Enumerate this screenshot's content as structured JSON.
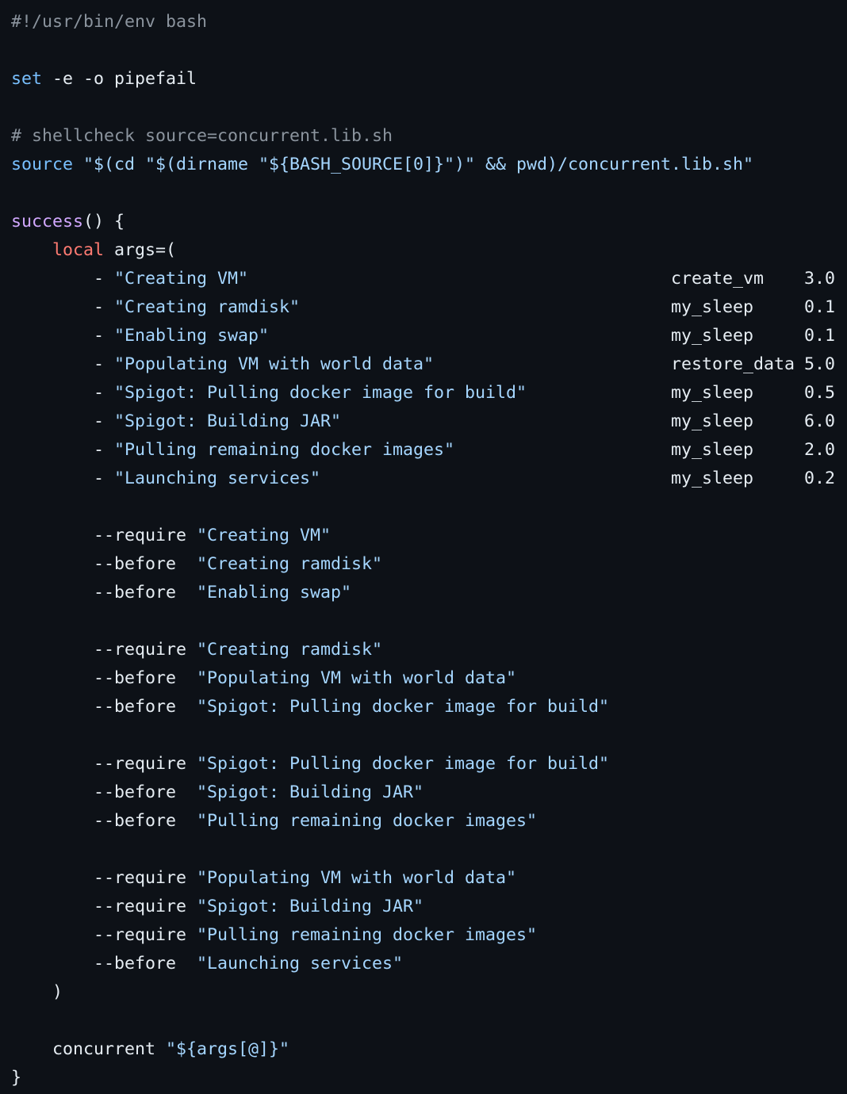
{
  "colors": {
    "background": "#0d1117",
    "text": "#e6edf3",
    "comment": "#8b949e",
    "keyword": "#79c0ff",
    "string": "#a5d6ff",
    "function": "#d2a8ff",
    "local": "#ff7b72"
  },
  "code": {
    "language": "bash",
    "lines": [
      [
        {
          "t": "#!/usr/bin/env bash",
          "c": "comment"
        }
      ],
      [],
      [
        {
          "t": "set",
          "c": "keyword"
        },
        {
          "t": " -e -o pipefail",
          "c": "plain"
        }
      ],
      [],
      [
        {
          "t": "# shellcheck source=concurrent.lib.sh",
          "c": "comment"
        }
      ],
      [
        {
          "t": "source",
          "c": "keyword"
        },
        {
          "t": " \"$(cd \"$(dirname \"${BASH_SOURCE[0]}\")\" && pwd)/concurrent.lib.sh\"",
          "c": "string"
        }
      ],
      [],
      [
        {
          "t": "success",
          "c": "func"
        },
        {
          "t": "() {",
          "c": "plain"
        }
      ],
      [
        {
          "t": "    ",
          "c": "plain"
        },
        {
          "t": "local",
          "c": "local"
        },
        {
          "t": " args=(",
          "c": "plain"
        }
      ],
      [
        {
          "t": "        - ",
          "c": "plain"
        },
        {
          "t": "\"Creating VM\"",
          "c": "string"
        }
      ],
      [
        {
          "t": "        - ",
          "c": "plain"
        },
        {
          "t": "\"Creating ramdisk\"",
          "c": "string"
        }
      ],
      [
        {
          "t": "        - ",
          "c": "plain"
        },
        {
          "t": "\"Enabling swap\"",
          "c": "string"
        }
      ],
      [
        {
          "t": "        - ",
          "c": "plain"
        },
        {
          "t": "\"Populating VM with world data\"",
          "c": "string"
        }
      ],
      [
        {
          "t": "        - ",
          "c": "plain"
        },
        {
          "t": "\"Spigot: Pulling docker image for build\"",
          "c": "string"
        }
      ],
      [
        {
          "t": "        - ",
          "c": "plain"
        },
        {
          "t": "\"Spigot: Building JAR\"",
          "c": "string"
        }
      ],
      [
        {
          "t": "        - ",
          "c": "plain"
        },
        {
          "t": "\"Pulling remaining docker images\"",
          "c": "string"
        }
      ],
      [
        {
          "t": "        - ",
          "c": "plain"
        },
        {
          "t": "\"Launching services\"",
          "c": "string"
        }
      ],
      [],
      [
        {
          "t": "        --require ",
          "c": "plain"
        },
        {
          "t": "\"Creating VM\"",
          "c": "string"
        }
      ],
      [
        {
          "t": "        --before  ",
          "c": "plain"
        },
        {
          "t": "\"Creating ramdisk\"",
          "c": "string"
        }
      ],
      [
        {
          "t": "        --before  ",
          "c": "plain"
        },
        {
          "t": "\"Enabling swap\"",
          "c": "string"
        }
      ],
      [],
      [
        {
          "t": "        --require ",
          "c": "plain"
        },
        {
          "t": "\"Creating ramdisk\"",
          "c": "string"
        }
      ],
      [
        {
          "t": "        --before  ",
          "c": "plain"
        },
        {
          "t": "\"Populating VM with world data\"",
          "c": "string"
        }
      ],
      [
        {
          "t": "        --before  ",
          "c": "plain"
        },
        {
          "t": "\"Spigot: Pulling docker image for build\"",
          "c": "string"
        }
      ],
      [],
      [
        {
          "t": "        --require ",
          "c": "plain"
        },
        {
          "t": "\"Spigot: Pulling docker image for build\"",
          "c": "string"
        }
      ],
      [
        {
          "t": "        --before  ",
          "c": "plain"
        },
        {
          "t": "\"Spigot: Building JAR\"",
          "c": "string"
        }
      ],
      [
        {
          "t": "        --before  ",
          "c": "plain"
        },
        {
          "t": "\"Pulling remaining docker images\"",
          "c": "string"
        }
      ],
      [],
      [
        {
          "t": "        --require ",
          "c": "plain"
        },
        {
          "t": "\"Populating VM with world data\"",
          "c": "string"
        }
      ],
      [
        {
          "t": "        --require ",
          "c": "plain"
        },
        {
          "t": "\"Spigot: Building JAR\"",
          "c": "string"
        }
      ],
      [
        {
          "t": "        --require ",
          "c": "plain"
        },
        {
          "t": "\"Pulling remaining docker images\"",
          "c": "string"
        }
      ],
      [
        {
          "t": "        --before  ",
          "c": "plain"
        },
        {
          "t": "\"Launching services\"",
          "c": "string"
        }
      ],
      [
        {
          "t": "    )",
          "c": "plain"
        }
      ],
      [],
      [
        {
          "t": "    concurrent ",
          "c": "plain"
        },
        {
          "t": "\"${args[@]}\"",
          "c": "string"
        }
      ],
      [
        {
          "t": "}",
          "c": "plain"
        }
      ]
    ],
    "task_table": [
      {
        "line": 9,
        "fn": "create_vm",
        "dur": "3.0"
      },
      {
        "line": 10,
        "fn": "my_sleep",
        "dur": "0.1"
      },
      {
        "line": 11,
        "fn": "my_sleep",
        "dur": "0.1"
      },
      {
        "line": 12,
        "fn": "restore_data",
        "dur": "5.0"
      },
      {
        "line": 13,
        "fn": "my_sleep",
        "dur": "0.5"
      },
      {
        "line": 14,
        "fn": "my_sleep",
        "dur": "6.0"
      },
      {
        "line": 15,
        "fn": "my_sleep",
        "dur": "2.0"
      },
      {
        "line": 16,
        "fn": "my_sleep",
        "dur": "0.2"
      }
    ]
  }
}
